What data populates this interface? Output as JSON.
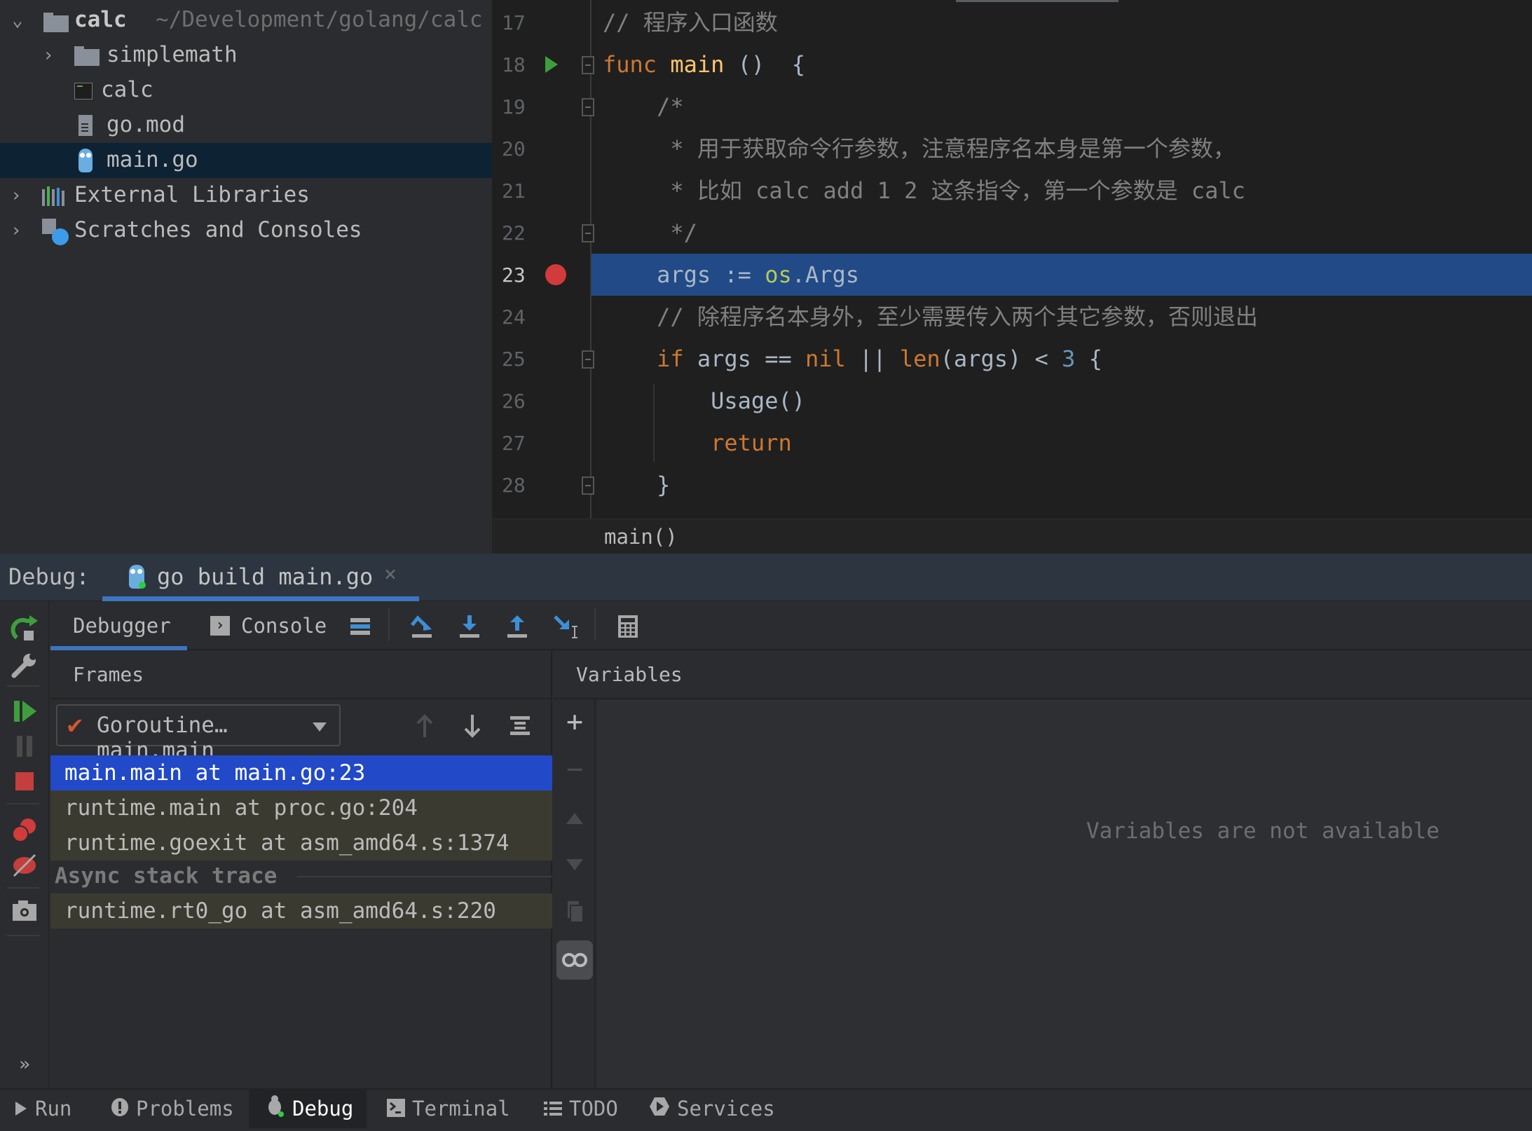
{
  "project_tree": {
    "root": {
      "name": "calc",
      "path": "~/Development/golang/calc",
      "expanded": true
    },
    "items": [
      {
        "label": "simplemath",
        "type": "folder",
        "expanded": false
      },
      {
        "label": "calc",
        "type": "executable"
      },
      {
        "label": "go.mod",
        "type": "text-file"
      },
      {
        "label": "main.go",
        "type": "go-file",
        "selected": true
      },
      {
        "label": "External Libraries",
        "type": "libraries",
        "expanded": false
      },
      {
        "label": "Scratches and Consoles",
        "type": "scratches",
        "expanded": false
      }
    ]
  },
  "editor": {
    "current_line": 23,
    "run_gutter_line": 18,
    "breakpoint_line": 23,
    "lines": [
      {
        "n": "17",
        "tokens": [
          [
            "cm",
            "// 程序入口函数"
          ]
        ]
      },
      {
        "n": "18",
        "tokens": [
          [
            "kw",
            "func "
          ],
          [
            "fn",
            "main"
          ],
          [
            "id",
            " ()  {"
          ]
        ]
      },
      {
        "n": "19",
        "tokens": [
          [
            "cm",
            "    /*"
          ]
        ]
      },
      {
        "n": "20",
        "tokens": [
          [
            "cm",
            "     * 用于获取命令行参数，注意程序名本身是第一个参数，"
          ]
        ]
      },
      {
        "n": "21",
        "tokens": [
          [
            "cm",
            "     * 比如 calc add 1 2 这条指令，第一个参数是 calc"
          ]
        ]
      },
      {
        "n": "22",
        "tokens": [
          [
            "cm",
            "     */"
          ]
        ]
      },
      {
        "n": "23",
        "tokens": [
          [
            "id",
            "    args := "
          ],
          [
            "pkg",
            "os"
          ],
          [
            "id",
            ".Args"
          ]
        ]
      },
      {
        "n": "24",
        "tokens": [
          [
            "cm",
            "    // 除程序名本身外，至少需要传入两个其它参数，否则退出"
          ]
        ]
      },
      {
        "n": "25",
        "tokens": [
          [
            "kw",
            "    if "
          ],
          [
            "id",
            "args == "
          ],
          [
            "kw",
            "nil"
          ],
          [
            "id",
            " || "
          ],
          [
            "kw",
            "len"
          ],
          [
            "id",
            "(args) < "
          ],
          [
            "num",
            "3"
          ],
          [
            "id",
            " {"
          ]
        ]
      },
      {
        "n": "26",
        "tokens": [
          [
            "id",
            "        Usage()"
          ]
        ]
      },
      {
        "n": "27",
        "tokens": [
          [
            "kw",
            "        return"
          ]
        ]
      },
      {
        "n": "28",
        "tokens": [
          [
            "id",
            "    }"
          ]
        ]
      }
    ],
    "breadcrumb": "main()"
  },
  "debug": {
    "title": "Debug:",
    "run_config_tab": "go build main.go",
    "tabs": [
      {
        "label": "Debugger",
        "active": true
      },
      {
        "label": "Console",
        "active": false
      }
    ],
    "toolbar_icons": [
      "show-execution-point-icon",
      "step-over-icon",
      "step-into-icon",
      "step-out-icon",
      "run-to-cursor-icon",
      "evaluate-expression-icon"
    ],
    "left_toolbar_icons": [
      "rerun-icon",
      "settings-wrench-icon",
      "resume-icon",
      "pause-icon",
      "stop-icon",
      "view-breakpoints-icon",
      "mute-breakpoints-icon",
      "camera-icon",
      "more-icon"
    ],
    "frames": {
      "header": "Frames",
      "goroutine": "Goroutine…main.main",
      "items": [
        {
          "label": "main.main at main.go:23",
          "selected": true
        },
        {
          "label": "runtime.main at proc.go:204",
          "selected": false
        },
        {
          "label": "runtime.goexit at asm_amd64.s:1374",
          "selected": false
        }
      ],
      "async_label": "Async stack trace",
      "async_items": [
        {
          "label": "runtime.rt0_go at asm_amd64.s:220"
        }
      ]
    },
    "variables": {
      "header": "Variables",
      "empty_text": "Variables are not available"
    }
  },
  "bottom_bar": {
    "items": [
      {
        "label": "Run",
        "icon": "play-icon",
        "active": false
      },
      {
        "label": "Problems",
        "icon": "problems-icon",
        "active": false
      },
      {
        "label": "Debug",
        "icon": "bug-icon",
        "active": true
      },
      {
        "label": "Terminal",
        "icon": "terminal-icon",
        "active": false
      },
      {
        "label": "TODO",
        "icon": "list-icon",
        "active": false
      },
      {
        "label": "Services",
        "icon": "services-icon",
        "active": false
      }
    ]
  },
  "colors": {
    "selection_blue": "#214a87",
    "frame_selected": "#2149c8",
    "breakpoint_red": "#d13b3b",
    "keyword_orange": "#cc7832",
    "function_yellow": "#ffc66d",
    "accent_tab": "#3d74c0"
  }
}
